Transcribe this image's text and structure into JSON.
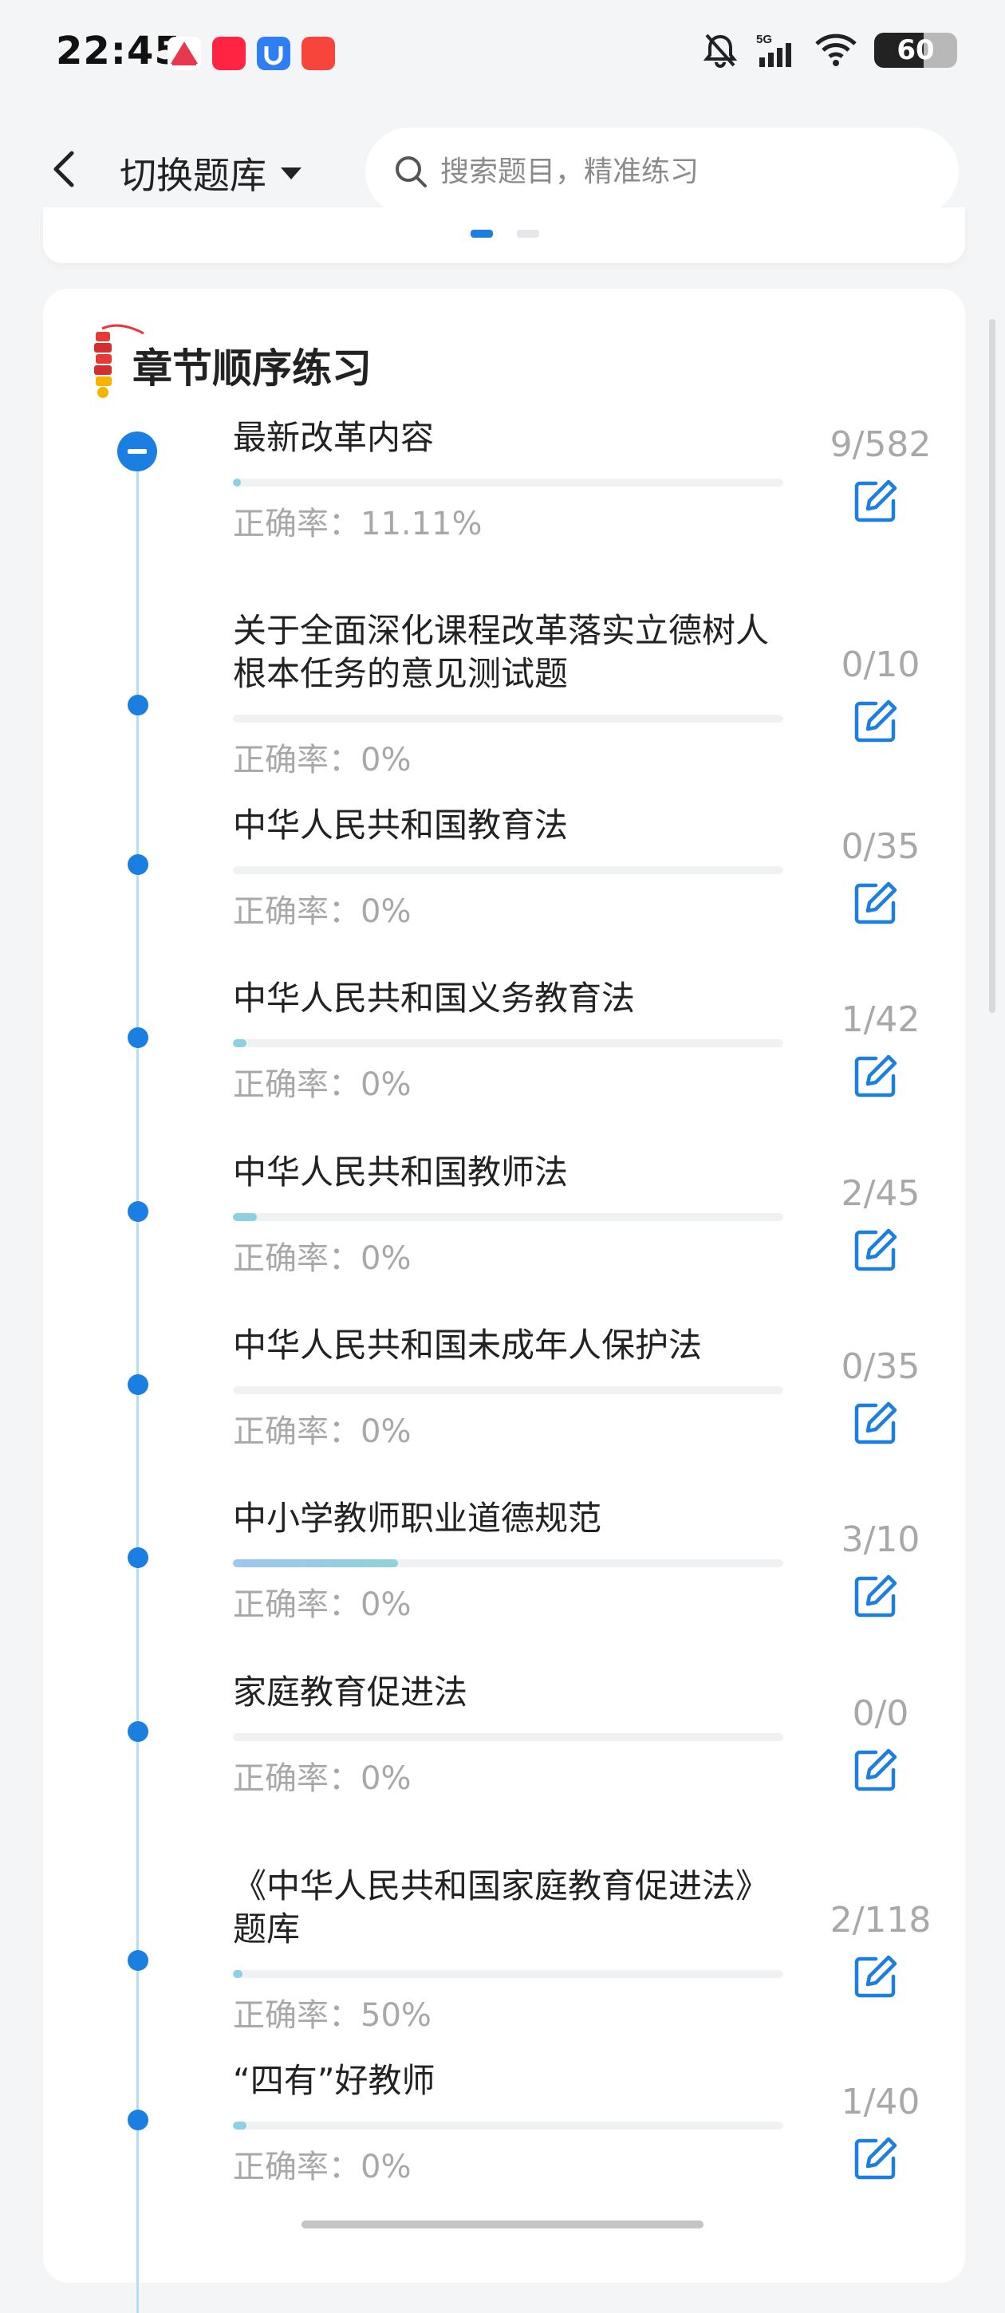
{
  "status_bar": {
    "time": "22:45",
    "battery": "60",
    "network": "5G",
    "app_icons": [
      "app-icon-1",
      "xiaohongshu-icon",
      "app-icon-3",
      "app-icon-4"
    ]
  },
  "header": {
    "switch_label": "切换题库",
    "search_placeholder": "搜索题目，精准练习"
  },
  "section": {
    "title": "章节顺序练习"
  },
  "accent_color": "#1a7fe0",
  "chapters": [
    {
      "title": "最新改革内容",
      "count": "9/582",
      "accuracy": "正确率：11.11%",
      "progress": 0.015
    },
    {
      "title": "关于全面深化课程改革落实立德树人根本任务的意见测试题",
      "count": "0/10",
      "accuracy": "正确率：0%",
      "progress": 0
    },
    {
      "title": "中华人民共和国教育法",
      "count": "0/35",
      "accuracy": "正确率：0%",
      "progress": 0
    },
    {
      "title": "中华人民共和国义务教育法",
      "count": "1/42",
      "accuracy": "正确率：0%",
      "progress": 0.024
    },
    {
      "title": "中华人民共和国教师法",
      "count": "2/45",
      "accuracy": "正确率：0%",
      "progress": 0.044
    },
    {
      "title": "中华人民共和国未成年人保护法",
      "count": "0/35",
      "accuracy": "正确率：0%",
      "progress": 0
    },
    {
      "title": "中小学教师职业道德规范",
      "count": "3/10",
      "accuracy": "正确率：0%",
      "progress": 0.3
    },
    {
      "title": "家庭教育促进法",
      "count": "0/0",
      "accuracy": "正确率：0%",
      "progress": 0
    },
    {
      "title": "《中华人民共和国家庭教育促进法》题库",
      "count": "2/118",
      "accuracy": "正确率：50%",
      "progress": 0.017
    },
    {
      "title": "“四有”好教师",
      "count": "1/40",
      "accuracy": "正确率：0%",
      "progress": 0.025
    }
  ]
}
